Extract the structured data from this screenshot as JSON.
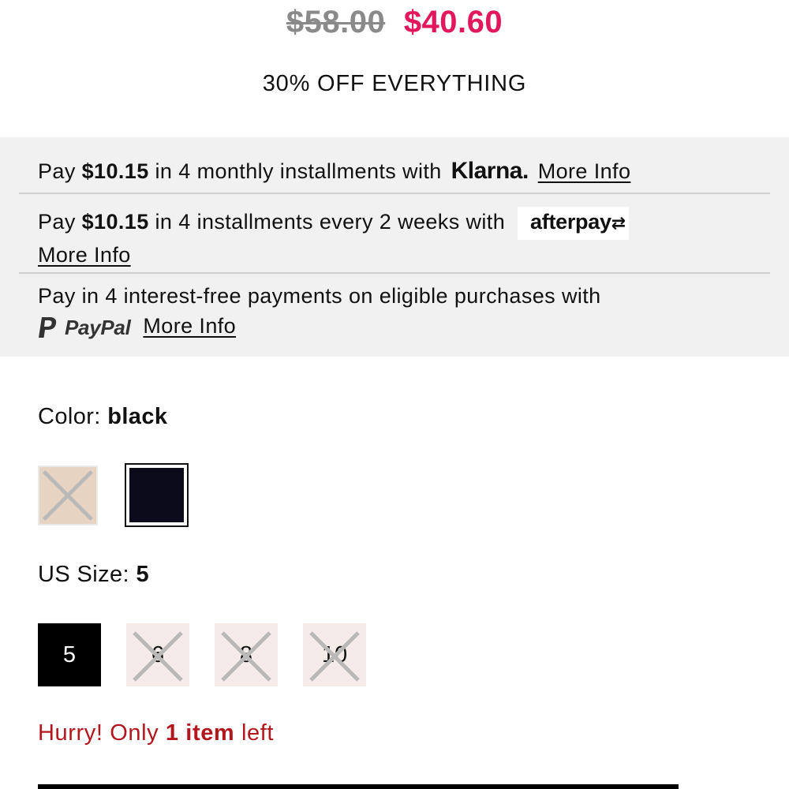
{
  "price": {
    "original": "$58.00",
    "sale": "$40.60"
  },
  "promo_text": "30% OFF EVERYTHING",
  "payments": {
    "klarna": {
      "prefix": "Pay",
      "amount": "$10.15",
      "middle": "in 4 monthly installments with",
      "logo_text": "Klarna.",
      "link": "More Info"
    },
    "afterpay": {
      "prefix": "Pay",
      "amount": "$10.15",
      "middle": "in 4 installments every 2 weeks with",
      "logo_text": "afterpay",
      "link": "More Info"
    },
    "paypal": {
      "text": "Pay in 4 interest-free payments on eligible purchases with",
      "logo_text": "PayPal",
      "link": "More Info"
    }
  },
  "color": {
    "label": "Color:",
    "value": "black",
    "swatches": [
      {
        "name": "nude",
        "available": false
      },
      {
        "name": "black",
        "available": true,
        "selected": true
      }
    ]
  },
  "size": {
    "label": "US Size:",
    "value": "5",
    "options": [
      "5",
      "6",
      "8",
      "10"
    ]
  },
  "stock": {
    "prefix": "Hurry! Only",
    "count": "1 item",
    "suffix": "left"
  },
  "colors": {
    "sale_price": "#e3175e",
    "stock_warning": "#b3171d",
    "pay_box_bg": "#f1f1f1",
    "unavailable_size_bg": "#f5ebe8"
  }
}
